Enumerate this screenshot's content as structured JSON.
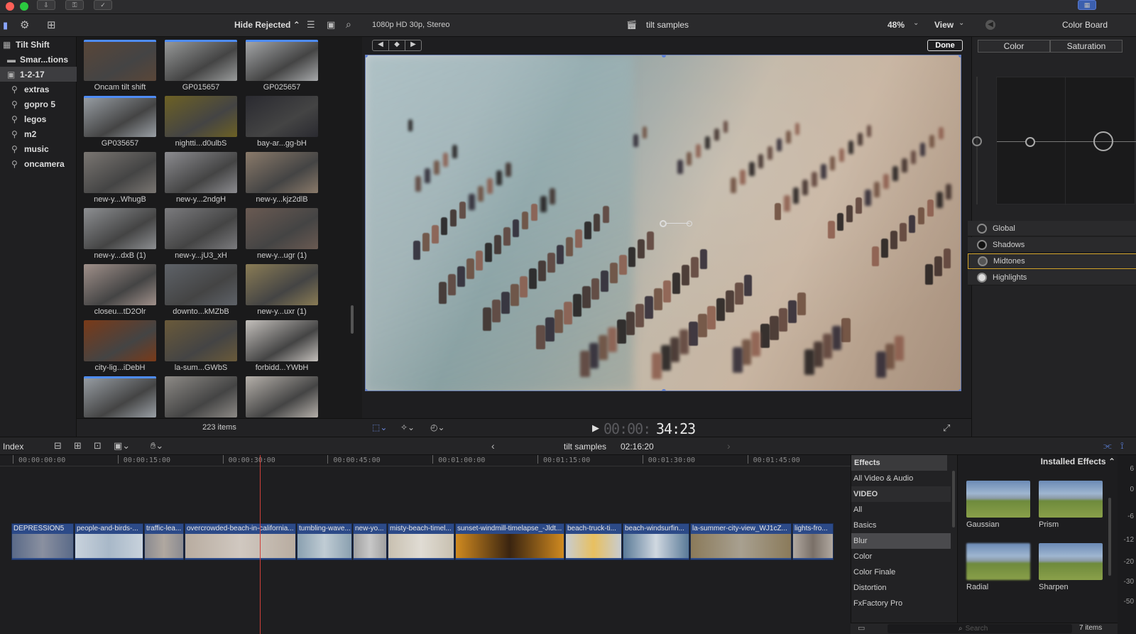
{
  "browser": {
    "filter_label": "Hide Rejected ⌃",
    "items_count": "223 items"
  },
  "sidebar": {
    "library": "Tilt Shift",
    "items": [
      {
        "label": "Smar...tions",
        "icon": "folder-icon"
      },
      {
        "label": "1-2-17",
        "icon": "event-icon"
      },
      {
        "label": "extras",
        "icon": "keyword-icon"
      },
      {
        "label": "gopro 5",
        "icon": "keyword-icon"
      },
      {
        "label": "legos",
        "icon": "keyword-icon"
      },
      {
        "label": "m2",
        "icon": "keyword-icon"
      },
      {
        "label": "music",
        "icon": "keyword-icon"
      },
      {
        "label": "oncamera",
        "icon": "keyword-icon"
      }
    ]
  },
  "clips": [
    {
      "label": "Oncam tilt shift",
      "color": "#5a4638",
      "bar": true
    },
    {
      "label": "GP015657",
      "color": "#9a9c9c",
      "bar": true
    },
    {
      "label": "GP025657",
      "color": "#a7a9ab",
      "bar": true
    },
    {
      "label": "GP035657",
      "color": "#9aa0a6",
      "bar": true
    },
    {
      "label": "nightti...d0ulbS",
      "color": "#6d6124",
      "bar": false
    },
    {
      "label": "bay-ar...gg-bH",
      "color": "#2a2a30",
      "bar": false
    },
    {
      "label": "new-y...WhugB",
      "color": "#7a7672",
      "bar": false
    },
    {
      "label": "new-y...2ndgH",
      "color": "#8c8c90",
      "bar": false
    },
    {
      "label": "new-y...kjz2dlB",
      "color": "#8a7a6a",
      "bar": false
    },
    {
      "label": "new-y...dxB (1)",
      "color": "#8d8f92",
      "bar": false
    },
    {
      "label": "new-y...jU3_xH",
      "color": "#7b7b7e",
      "bar": false
    },
    {
      "label": "new-y...ugr (1)",
      "color": "#6a5a52",
      "bar": false
    },
    {
      "label": "closeu...tD2Olr",
      "color": "#a0908a",
      "bar": false
    },
    {
      "label": "downto...kMZbB",
      "color": "#5e6268",
      "bar": false
    },
    {
      "label": "new-y...uxr (1)",
      "color": "#8a7c55",
      "bar": false
    },
    {
      "label": "city-lig...iDebH",
      "color": "#7a3a18",
      "bar": false
    },
    {
      "label": "la-sum...GWbS",
      "color": "#6a5a3a",
      "bar": false
    },
    {
      "label": "forbidd...YWbH",
      "color": "#c4c0bc",
      "bar": false
    },
    {
      "label": "",
      "color": "#9aa0a6",
      "bar": true
    },
    {
      "label": "",
      "color": "#8d8a86",
      "bar": false
    },
    {
      "label": "",
      "color": "#b5b0aa",
      "bar": false
    }
  ],
  "viewer": {
    "format": "1080p HD 30p, Stereo",
    "project": "tilt samples",
    "zoom": "48%",
    "view_label": "View",
    "done_label": "Done",
    "timecode_dim": "00:00:",
    "timecode_bright": "34:23"
  },
  "inspector": {
    "title": "Color Board",
    "tabs": [
      "Color",
      "Saturation"
    ],
    "ranges": [
      "Global",
      "Shadows",
      "Midtones",
      "Highlights"
    ],
    "selected_range": "Midtones"
  },
  "timeline_bar": {
    "index_label": "Index",
    "project": "tilt samples",
    "duration": "02:16:20"
  },
  "ruler": [
    "00:00:00:00",
    "00:00:15:00",
    "00:00:30:00",
    "00:00:45:00",
    "00:01:00:00",
    "00:01:15:00",
    "00:01:30:00",
    "00:01:45:00"
  ],
  "timeline_clips": [
    {
      "name": "DEPRESSION5",
      "w": 88,
      "c1": "#5a6a88",
      "c2": "#8a90a0"
    },
    {
      "name": "people-and-birds-...",
      "w": 97,
      "c1": "#c8d2dc",
      "c2": "#a8b8c8"
    },
    {
      "name": "traffic-lea...",
      "w": 56,
      "c1": "#8a8a90",
      "c2": "#b0a8a0"
    },
    {
      "name": "overcrowded-beach-in-california...",
      "w": 157,
      "c1": "#b8aca0",
      "c2": "#d0c8c0"
    },
    {
      "name": "tumbling-wave...",
      "w": 78,
      "c1": "#8aa0b0",
      "c2": "#c0ccd4"
    },
    {
      "name": "new-yo...",
      "w": 48,
      "c1": "#a0a0a0",
      "c2": "#c8c8c8"
    },
    {
      "name": "misty-beach-timel...",
      "w": 94,
      "c1": "#c8c0b0",
      "c2": "#e0dcd4"
    },
    {
      "name": "sunset-windmill-timelapse_-Jldt...",
      "w": 154,
      "c1": "#d08a20",
      "c2": "#3a2410"
    },
    {
      "name": "beach-truck-ti...",
      "w": 80,
      "c1": "#c8ccd0",
      "c2": "#e8c060"
    },
    {
      "name": "beach-windsurfin...",
      "w": 94,
      "c1": "#5a7a98",
      "c2": "#d0d8e0"
    },
    {
      "name": "la-summer-city-view_WJ1cZ...",
      "w": 143,
      "c1": "#8a7a5a",
      "c2": "#a8a090"
    },
    {
      "name": "lights-fro...",
      "w": 58,
      "c1": "#b0a8a0",
      "c2": "#7a7068"
    }
  ],
  "effects": {
    "header": "Effects",
    "installed_label": "Installed Effects ⌃",
    "categories": [
      "All Video & Audio",
      "VIDEO",
      "All",
      "Basics",
      "Blur",
      "Color",
      "Color Finale",
      "Distortion",
      "FxFactory Pro"
    ],
    "selected": "Blur",
    "items": [
      "Gaussian",
      "Prism",
      "Radial",
      "Sharpen"
    ],
    "search_placeholder": "Search",
    "count": "7 items"
  },
  "meter": [
    "6",
    "0",
    "-6",
    "-12",
    "-20",
    "-30",
    "-50"
  ]
}
